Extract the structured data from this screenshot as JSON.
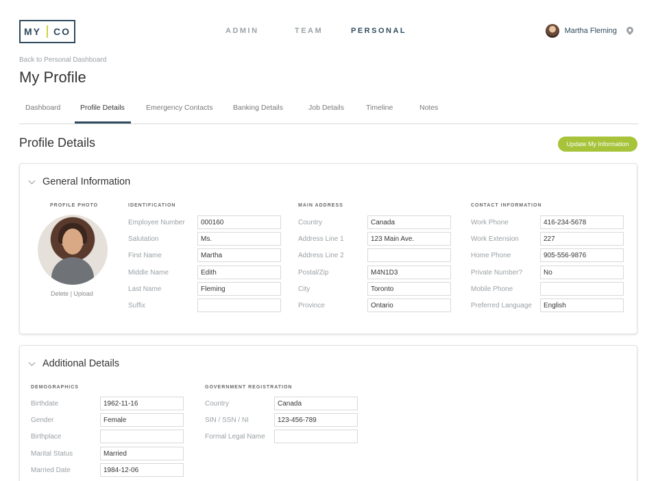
{
  "brand": {
    "left": "MY",
    "right": "CO"
  },
  "nav": {
    "admin": "ADMIN",
    "team": "TEAM",
    "personal": "PERSONAL"
  },
  "user": {
    "name": "Martha Fleming"
  },
  "breadcrumb": "Back to Personal Dashboard",
  "page_title": "My Profile",
  "tabs": [
    "Dashboard",
    "Profile Details",
    "Emergency Contacts",
    "Banking Details",
    "Job Details",
    "Timeline",
    "Notes"
  ],
  "section_title": "Profile Details",
  "update_button": "Update My Information",
  "general": {
    "title": "General Information",
    "photo_label": "PROFILE PHOTO",
    "photo_delete": "Delete",
    "photo_sep": "|",
    "photo_upload": "Upload",
    "identification": {
      "label": "IDENTIFICATION",
      "fields": [
        {
          "label": "Employee Number",
          "value": "000160"
        },
        {
          "label": "Salutation",
          "value": "Ms."
        },
        {
          "label": "First Name",
          "value": "Martha"
        },
        {
          "label": "Middle Name",
          "value": "Edith"
        },
        {
          "label": "Last Name",
          "value": "Fleming"
        },
        {
          "label": "Suffix",
          "value": ""
        }
      ]
    },
    "address": {
      "label": "MAIN ADDRESS",
      "fields": [
        {
          "label": "Country",
          "value": "Canada"
        },
        {
          "label": "Address Line 1",
          "value": "123 Main Ave."
        },
        {
          "label": "Address Line 2",
          "value": ""
        },
        {
          "label": "Postal/Zip",
          "value": "M4N1D3"
        },
        {
          "label": "City",
          "value": "Toronto"
        },
        {
          "label": "Province",
          "value": "Ontario"
        }
      ]
    },
    "contact": {
      "label": "CONTACT INFORMATION",
      "fields": [
        {
          "label": "Work Phone",
          "value": "416-234-5678"
        },
        {
          "label": "Work Extension",
          "value": "227"
        },
        {
          "label": "Home Phone",
          "value": "905-556-9876"
        },
        {
          "label": "Private Number?",
          "value": "No"
        },
        {
          "label": "Mobile Phone",
          "value": ""
        },
        {
          "label": "Preferred Language",
          "value": "English"
        }
      ]
    }
  },
  "additional": {
    "title": "Additional Details",
    "demographics": {
      "label": "DEMOGRAPHICS",
      "fields": [
        {
          "label": "Birthdate",
          "value": "1962-11-16"
        },
        {
          "label": "Gender",
          "value": "Female"
        },
        {
          "label": "Birthplace",
          "value": ""
        },
        {
          "label": "Marital Status",
          "value": "Married"
        },
        {
          "label": "Married Date",
          "value": "1984-12-06"
        }
      ]
    },
    "government": {
      "label": "GOVERNMENT REGISTRATION",
      "fields": [
        {
          "label": "Country",
          "value": "Canada"
        },
        {
          "label": "SIN / SSN / NI",
          "value": "123-456-789"
        },
        {
          "label": "Formal Legal Name",
          "value": ""
        }
      ]
    }
  },
  "colors": {
    "accent": "#a6c33a",
    "brand": "#2e4a5c"
  }
}
